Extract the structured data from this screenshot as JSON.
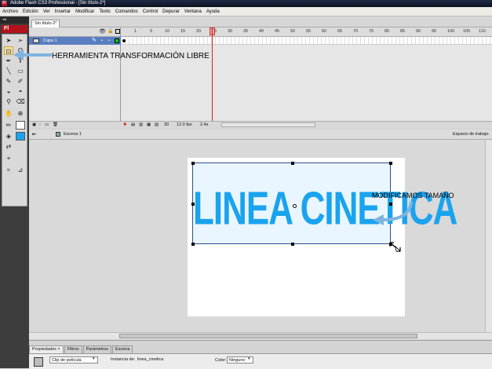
{
  "window": {
    "title": "Adobe Flash CS3 Professional - [Sin título-2*]",
    "icon_label": "Fl"
  },
  "menu": [
    "Archivo",
    "Edición",
    "Ver",
    "Insertar",
    "Modificar",
    "Texto",
    "Comandos",
    "Control",
    "Depurar",
    "Ventana",
    "Ayuda"
  ],
  "toolbox": {
    "header": "◂◂",
    "logo": "Fl"
  },
  "document": {
    "tab": "Sin título-2*"
  },
  "timeline": {
    "layer_name": "Capa 1",
    "ruler": [
      "1",
      "5",
      "10",
      "15",
      "20",
      "25",
      "30",
      "35",
      "40",
      "45",
      "50",
      "55",
      "60",
      "65",
      "70",
      "75",
      "80",
      "85",
      "90",
      "95",
      "100",
      "105",
      "110",
      "115"
    ],
    "current_frame": "30",
    "fps": "12.0 fps",
    "elapsed": "2.4s"
  },
  "scene": {
    "label": "Escena 1",
    "workspace": "Espacio de trabajo"
  },
  "stage": {
    "text": "LINEA CINETICA"
  },
  "annotations": {
    "free_transform": "HERRAMIENTA TRANSFORMACIÓN LIBRE",
    "resize": "MODIFICAMOS TAMAÑO"
  },
  "properties": {
    "tabs": [
      "Propiedades ×",
      "Filtros",
      "Parámetros",
      "Escena"
    ],
    "symbol_type": "Clip de película",
    "instance_label": "Instancia de:",
    "instance_name": "linea_cinetica",
    "color_label": "Color:",
    "color_value": "Ninguno"
  },
  "colors": {
    "text_blue": "#1aa3ee",
    "arrow_blue": "#7fb4e0",
    "selection": "#2c4f8f",
    "playhead": "#e02020"
  }
}
